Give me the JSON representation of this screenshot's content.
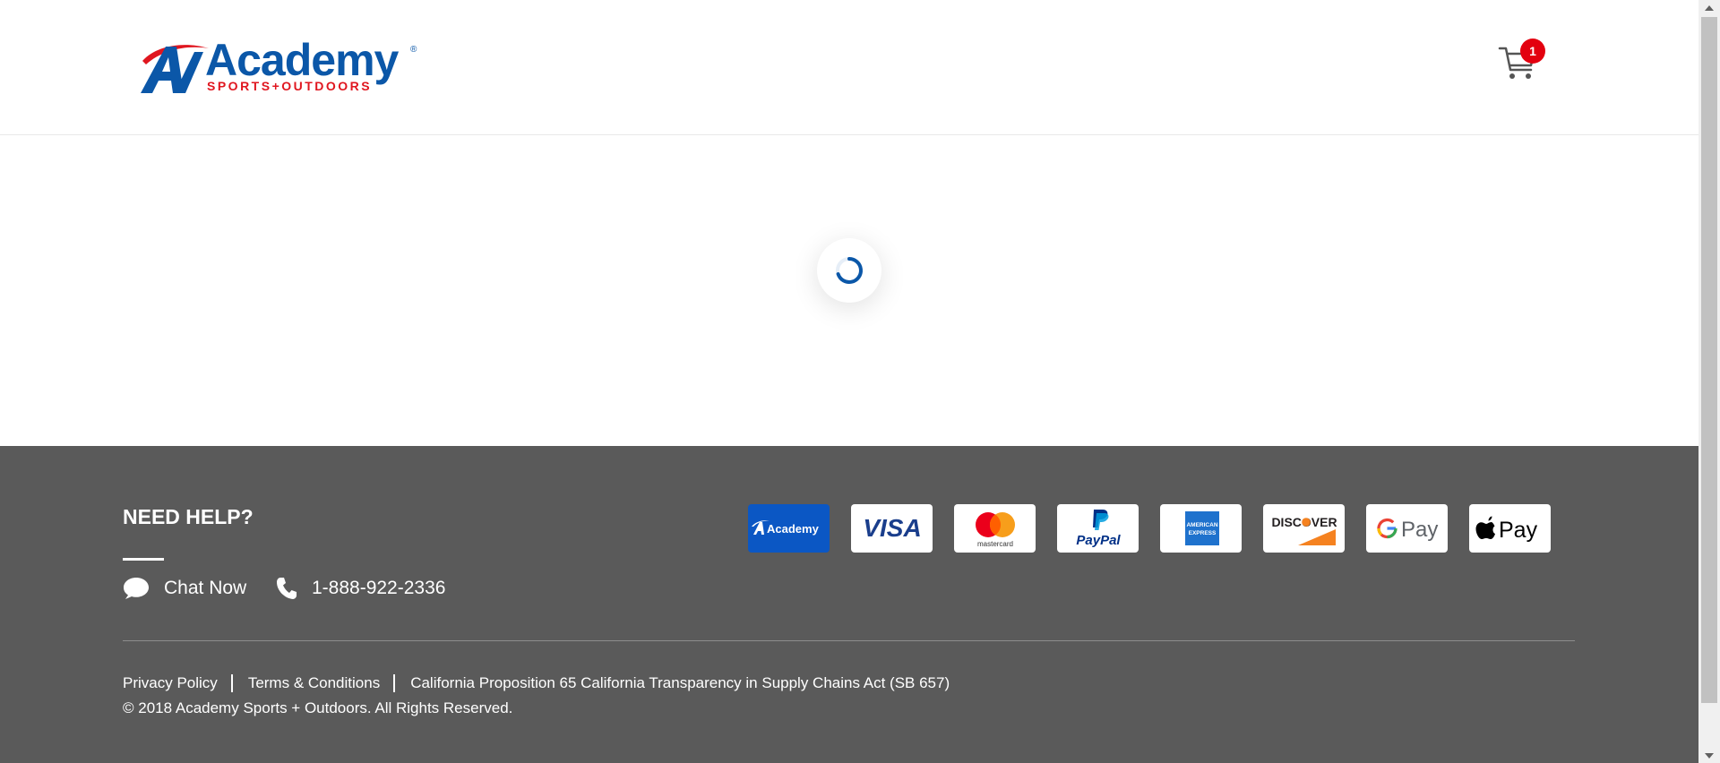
{
  "header": {
    "logo": {
      "brand": "Academy",
      "tagline": "SPORTS+OUTDOORS",
      "registered": "®"
    },
    "cart": {
      "icon": "cart-icon",
      "count": "1"
    }
  },
  "main": {
    "loading_icon": "spinner-icon"
  },
  "footer": {
    "help_title": "NEED HELP?",
    "chat": {
      "icon": "chat-bubble-icon",
      "label": "Chat Now"
    },
    "phone": {
      "icon": "phone-icon",
      "label": "1-888-922-2336"
    },
    "payments": [
      {
        "name": "Academy",
        "icon": "academy-card-icon"
      },
      {
        "name": "VISA",
        "icon": "visa-icon"
      },
      {
        "name": "mastercard",
        "icon": "mastercard-icon"
      },
      {
        "name": "PayPal",
        "icon": "paypal-icon"
      },
      {
        "name": "AMERICAN EXPRESS",
        "icon": "amex-icon"
      },
      {
        "name": "DISCOVER",
        "icon": "discover-icon"
      },
      {
        "name": "G Pay",
        "icon": "google-pay-icon"
      },
      {
        "name": "Pay",
        "icon": "apple-pay-icon"
      }
    ],
    "links": [
      {
        "label": "Privacy Policy"
      },
      {
        "label": "Terms & Conditions"
      },
      {
        "label": "California Proposition 65 California Transparency in Supply Chains Act (SB 657)"
      }
    ],
    "copyright": "© 2018 Academy Sports + Outdoors. All Rights Reserved."
  },
  "colors": {
    "brand_blue": "#0b57a8",
    "brand_red": "#e0161f",
    "footer_bg": "#5a5a5a",
    "badge_red": "#e3000f",
    "mastercard_orange": "#ff5f00",
    "discover_orange": "#f58220"
  }
}
